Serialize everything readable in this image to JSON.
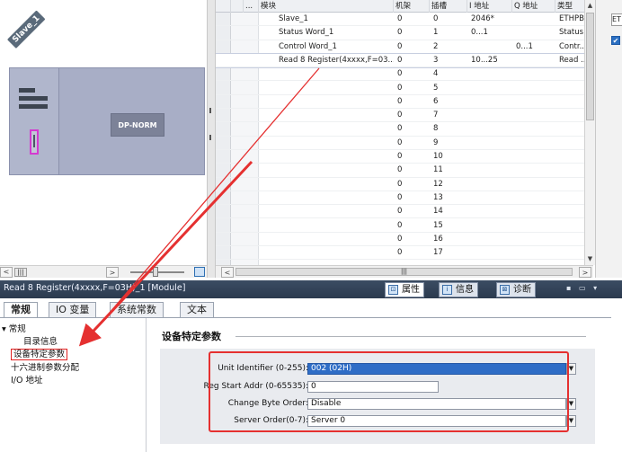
{
  "device": {
    "name_label": "Slave_1",
    "module_label": "DP-NORM"
  },
  "table": {
    "columns": [
      "",
      "...",
      "模块",
      "机架",
      "插槽",
      "I 地址",
      "Q 地址",
      "类型"
    ],
    "rows": [
      {
        "module": "Slave_1",
        "rack": "0",
        "slot": "0",
        "i_addr": "2046*",
        "q_addr": "",
        "type": "ETHPB"
      },
      {
        "module": "Status Word_1",
        "rack": "0",
        "slot": "1",
        "i_addr": "0...1",
        "q_addr": "",
        "type": "Status..."
      },
      {
        "module": "Control Word_1",
        "rack": "0",
        "slot": "2",
        "i_addr": "",
        "q_addr": "0...1",
        "type": "Contr..."
      },
      {
        "module": "Read 8 Register(4xxxx,F=03...",
        "rack": "0",
        "slot": "3",
        "i_addr": "10...25",
        "q_addr": "",
        "type": "Read ..."
      },
      {
        "module": "",
        "rack": "0",
        "slot": "4",
        "i_addr": "",
        "q_addr": "",
        "type": ""
      },
      {
        "module": "",
        "rack": "0",
        "slot": "5",
        "i_addr": "",
        "q_addr": "",
        "type": ""
      },
      {
        "module": "",
        "rack": "0",
        "slot": "6",
        "i_addr": "",
        "q_addr": "",
        "type": ""
      },
      {
        "module": "",
        "rack": "0",
        "slot": "7",
        "i_addr": "",
        "q_addr": "",
        "type": ""
      },
      {
        "module": "",
        "rack": "0",
        "slot": "8",
        "i_addr": "",
        "q_addr": "",
        "type": ""
      },
      {
        "module": "",
        "rack": "0",
        "slot": "9",
        "i_addr": "",
        "q_addr": "",
        "type": ""
      },
      {
        "module": "",
        "rack": "0",
        "slot": "10",
        "i_addr": "",
        "q_addr": "",
        "type": ""
      },
      {
        "module": "",
        "rack": "0",
        "slot": "11",
        "i_addr": "",
        "q_addr": "",
        "type": ""
      },
      {
        "module": "",
        "rack": "0",
        "slot": "12",
        "i_addr": "",
        "q_addr": "",
        "type": ""
      },
      {
        "module": "",
        "rack": "0",
        "slot": "13",
        "i_addr": "",
        "q_addr": "",
        "type": ""
      },
      {
        "module": "",
        "rack": "0",
        "slot": "14",
        "i_addr": "",
        "q_addr": "",
        "type": ""
      },
      {
        "module": "",
        "rack": "0",
        "slot": "15",
        "i_addr": "",
        "q_addr": "",
        "type": ""
      },
      {
        "module": "",
        "rack": "0",
        "slot": "16",
        "i_addr": "",
        "q_addr": "",
        "type": ""
      },
      {
        "module": "",
        "rack": "0",
        "slot": "17",
        "i_addr": "",
        "q_addr": "",
        "type": ""
      }
    ]
  },
  "right_edge": {
    "text": "ET"
  },
  "properties": {
    "title": "Read 8 Register(4xxxx,F=03H)_1 [Module]",
    "tabs": [
      {
        "label": "属性",
        "icon": "properties-icon"
      },
      {
        "label": "信息",
        "icon": "info-icon"
      },
      {
        "label": "诊断",
        "icon": "diagnostics-icon"
      }
    ],
    "subtabs": [
      "常规",
      "IO 变量",
      "系统常数",
      "文本"
    ],
    "tree": {
      "root": "常规",
      "items": [
        "目录信息",
        "设备特定参数",
        "十六进制参数分配",
        "I/O 地址"
      ]
    },
    "section_title": "设备特定参数",
    "params": [
      {
        "label": "Unit Identifier (0-255):",
        "value": "002 (02H)",
        "dropdown": true
      },
      {
        "label": "Reg Start Addr (0-65535):",
        "value": "0",
        "dropdown": false
      },
      {
        "label": "Change Byte Order:",
        "value": "Disable",
        "dropdown": true
      },
      {
        "label": "Server Order(0-7):",
        "value": "Server 0",
        "dropdown": true
      }
    ]
  },
  "colors": {
    "accent_red": "#e53030",
    "selected_blue": "#2f6dc6",
    "title_bar": "#2f3f55",
    "device_body": "#a8aec6"
  }
}
